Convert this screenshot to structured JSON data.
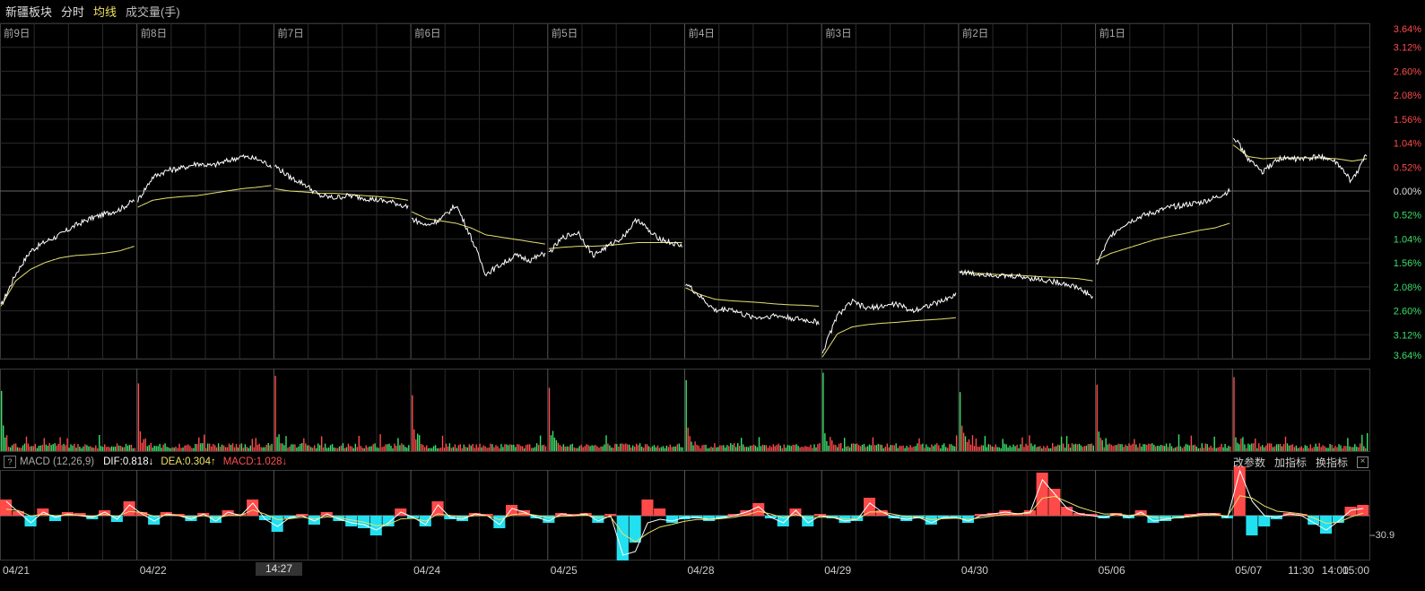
{
  "header": {
    "title": "新疆板块",
    "mode": "分时",
    "avg_label": "均线",
    "volume_label": "成交量(手)"
  },
  "macd_header": {
    "help": "?",
    "name": "MACD (12,26,9)",
    "dif": "DIF:0.818↓",
    "dea": "DEA:0.304↑",
    "macd": "MACD:1.028↓",
    "tools": [
      "改参数",
      "加指标",
      "换指标"
    ],
    "close": "×"
  },
  "cursor_time": "14:27",
  "macd_value_tag": "-30.9",
  "colors": {
    "background": "#000000",
    "grid": "#3a3a3a",
    "price_line": "#ffffff",
    "avg_line": "#e8e070",
    "up": "#ff4a4a",
    "down": "#3adf6a",
    "macd_down": "#22e0f0",
    "zero_line": "#888888"
  },
  "chart_data": {
    "type": "line",
    "day_labels": [
      "前9日",
      "前8日",
      "前7日",
      "前6日",
      "前5日",
      "前4日",
      "前3日",
      "前2日",
      "前1日",
      ""
    ],
    "date_labels": [
      "04/21",
      "04/22",
      "",
      "04/24",
      "04/25",
      "04/28",
      "04/29",
      "04/30",
      "05/06",
      "05/07"
    ],
    "last_day_time_labels": [
      "11:30",
      "14:00",
      "15:00"
    ],
    "y_ticks": [
      "3.64%",
      "3.12%",
      "2.60%",
      "2.08%",
      "1.56%",
      "1.04%",
      "0.52%",
      "0.00%",
      "0.52%",
      "1.04%",
      "1.56%",
      "2.08%",
      "2.60%",
      "3.12%",
      "3.64%"
    ],
    "y_tick_values": [
      3.64,
      3.12,
      2.6,
      2.08,
      1.56,
      1.04,
      0.52,
      0.0,
      -0.52,
      -1.04,
      -1.56,
      -2.08,
      -2.6,
      -3.12,
      -3.64
    ],
    "ylim": [
      -3.64,
      3.64
    ],
    "days": [
      {
        "price": [
          -2.5,
          -1.8,
          -1.3,
          -1.1,
          -0.95,
          -0.75,
          -0.6,
          -0.5,
          -0.4,
          -0.2
        ],
        "avg": [
          -2.5,
          -1.95,
          -1.7,
          -1.55,
          -1.45,
          -1.4,
          -1.38,
          -1.35,
          -1.3,
          -1.2
        ]
      },
      {
        "price": [
          -0.2,
          0.3,
          0.45,
          0.5,
          0.6,
          0.55,
          0.65,
          0.75,
          0.7,
          0.55
        ],
        "avg": [
          -0.35,
          -0.2,
          -0.15,
          -0.12,
          -0.1,
          -0.05,
          0.0,
          0.05,
          0.08,
          0.12
        ]
      },
      {
        "price": [
          0.55,
          0.3,
          0.15,
          -0.1,
          -0.15,
          -0.1,
          -0.15,
          -0.2,
          -0.25,
          -0.35
        ],
        "avg": [
          0.05,
          0.0,
          -0.02,
          -0.05,
          -0.05,
          -0.07,
          -0.1,
          -0.12,
          -0.15,
          -0.2
        ]
      },
      {
        "price": [
          -0.6,
          -0.75,
          -0.6,
          -0.3,
          -1.0,
          -1.8,
          -1.6,
          -1.4,
          -1.5,
          -1.35
        ],
        "avg": [
          -0.45,
          -0.6,
          -0.65,
          -0.7,
          -0.8,
          -0.95,
          -1.0,
          -1.05,
          -1.1,
          -1.15
        ]
      },
      {
        "price": [
          -1.35,
          -1.0,
          -0.9,
          -1.4,
          -1.2,
          -1.0,
          -0.6,
          -0.95,
          -1.1,
          -1.2
        ],
        "avg": [
          -1.25,
          -1.22,
          -1.2,
          -1.2,
          -1.18,
          -1.15,
          -1.12,
          -1.12,
          -1.12,
          -1.12
        ]
      },
      {
        "price": [
          -2.0,
          -2.3,
          -2.6,
          -2.55,
          -2.7,
          -2.75,
          -2.7,
          -2.75,
          -2.8,
          -2.85
        ],
        "avg": [
          -2.1,
          -2.25,
          -2.35,
          -2.38,
          -2.4,
          -2.42,
          -2.45,
          -2.47,
          -2.48,
          -2.5
        ]
      },
      {
        "price": [
          -3.5,
          -2.7,
          -2.4,
          -2.55,
          -2.5,
          -2.45,
          -2.6,
          -2.5,
          -2.4,
          -2.25
        ],
        "avg": [
          -3.6,
          -3.1,
          -2.95,
          -2.9,
          -2.87,
          -2.85,
          -2.82,
          -2.8,
          -2.78,
          -2.75
        ]
      },
      {
        "price": [
          -1.75,
          -1.8,
          -1.8,
          -1.85,
          -1.85,
          -1.9,
          -1.95,
          -2.0,
          -2.1,
          -2.3
        ],
        "avg": [
          -1.75,
          -1.78,
          -1.8,
          -1.82,
          -1.83,
          -1.85,
          -1.87,
          -1.88,
          -1.9,
          -1.95
        ]
      },
      {
        "price": [
          -1.6,
          -0.95,
          -0.7,
          -0.55,
          -0.45,
          -0.35,
          -0.3,
          -0.25,
          -0.15,
          0.0
        ],
        "avg": [
          -1.5,
          -1.35,
          -1.25,
          -1.15,
          -1.05,
          -0.98,
          -0.92,
          -0.85,
          -0.8,
          -0.7
        ]
      },
      {
        "price": [
          1.2,
          0.7,
          0.4,
          0.7,
          0.7,
          0.7,
          0.75,
          0.6,
          0.2,
          0.8
        ],
        "avg": [
          1.0,
          0.75,
          0.7,
          0.72,
          0.72,
          0.72,
          0.72,
          0.7,
          0.65,
          0.7
        ]
      }
    ],
    "macd": {
      "dif": [
        40,
        10,
        -20,
        10,
        -5,
        5,
        0,
        -5,
        10,
        -10,
        30,
        5,
        -15,
        5,
        0,
        -10,
        5,
        -15,
        10,
        0,
        35,
        -10,
        -30,
        -5,
        0,
        -15,
        5,
        -10,
        -20,
        -25,
        -40,
        -20,
        10,
        -5,
        -25,
        30,
        -5,
        -10,
        5,
        0,
        -25,
        20,
        10,
        -5,
        -15,
        5,
        0,
        5,
        -15,
        0,
        -110,
        -100,
        -20,
        -10,
        -15,
        -5,
        -5,
        -10,
        -5,
        0,
        10,
        25,
        -5,
        -20,
        15,
        -20,
        0,
        -5,
        -15,
        -10,
        35,
        10,
        -5,
        -10,
        -5,
        -20,
        -5,
        -5,
        -15,
        0,
        5,
        10,
        5,
        10,
        100,
        60,
        20,
        5,
        0,
        -5,
        5,
        -5,
        10,
        -15,
        -10,
        -5,
        0,
        5,
        5,
        -5,
        125,
        40,
        0,
        -5,
        5,
        0,
        -20,
        -40,
        -15,
        15,
        20
      ],
      "histogram": [
        18,
        5,
        -12,
        8,
        -6,
        4,
        3,
        -4,
        6,
        -7,
        16,
        4,
        -10,
        4,
        2,
        -6,
        3,
        -8,
        6,
        2,
        18,
        -5,
        -18,
        -3,
        2,
        -10,
        4,
        -6,
        -12,
        -14,
        -22,
        -12,
        8,
        -3,
        -12,
        16,
        -4,
        -6,
        3,
        2,
        -14,
        12,
        6,
        -3,
        -8,
        3,
        2,
        3,
        -8,
        2,
        -50,
        -30,
        18,
        8,
        -8,
        -4,
        -3,
        -6,
        -3,
        2,
        6,
        14,
        -3,
        -12,
        8,
        -12,
        2,
        -3,
        -8,
        -6,
        20,
        6,
        -3,
        -6,
        -3,
        -10,
        -3,
        -3,
        -8,
        2,
        3,
        6,
        3,
        6,
        48,
        30,
        10,
        3,
        2,
        -3,
        3,
        -3,
        6,
        -8,
        -6,
        -3,
        2,
        3,
        3,
        -3,
        55,
        -22,
        -12,
        -4,
        3,
        2,
        -10,
        -20,
        -8,
        10,
        12
      ]
    }
  }
}
